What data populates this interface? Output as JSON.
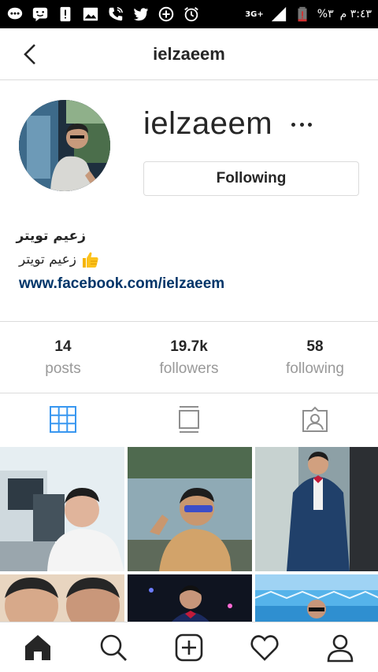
{
  "status_bar": {
    "time": "٣:٤٣ م",
    "battery_percent": "%٣",
    "network": "3G+",
    "icons": [
      "chat-icon",
      "messenger-icon",
      "alert-icon",
      "image-icon",
      "wifi-call-icon",
      "twitter-icon",
      "data-saver-icon",
      "alarm-icon",
      "signal-icon",
      "battery-icon"
    ]
  },
  "header": {
    "title": "ielzaeem",
    "back_icon": "chevron-left-icon"
  },
  "profile": {
    "username": "ielzaeem",
    "follow_button_label": "Following",
    "bio_name": "زعيم تويتر",
    "bio_text": "زعيم تويتر",
    "bio_emoji": "thumbs-up-icon",
    "website": "www.facebook.com/ielzaeem"
  },
  "stats": [
    {
      "value": "14",
      "label": "posts"
    },
    {
      "value": "19.7k",
      "label": "followers"
    },
    {
      "value": "58",
      "label": "following"
    }
  ],
  "tabs": [
    {
      "icon": "grid-icon",
      "active": true
    },
    {
      "icon": "feed-icon",
      "active": false
    },
    {
      "icon": "tagged-icon",
      "active": false
    }
  ],
  "bottom_nav": [
    {
      "icon": "home-icon",
      "active": true
    },
    {
      "icon": "search-icon",
      "active": false
    },
    {
      "icon": "add-post-icon",
      "active": false
    },
    {
      "icon": "heart-icon",
      "active": false
    },
    {
      "icon": "profile-icon",
      "active": false
    }
  ],
  "colors": {
    "accent_blue": "#3897f0",
    "link": "#003569",
    "text": "#262626",
    "muted": "#999999",
    "border": "#dbdbdb"
  }
}
